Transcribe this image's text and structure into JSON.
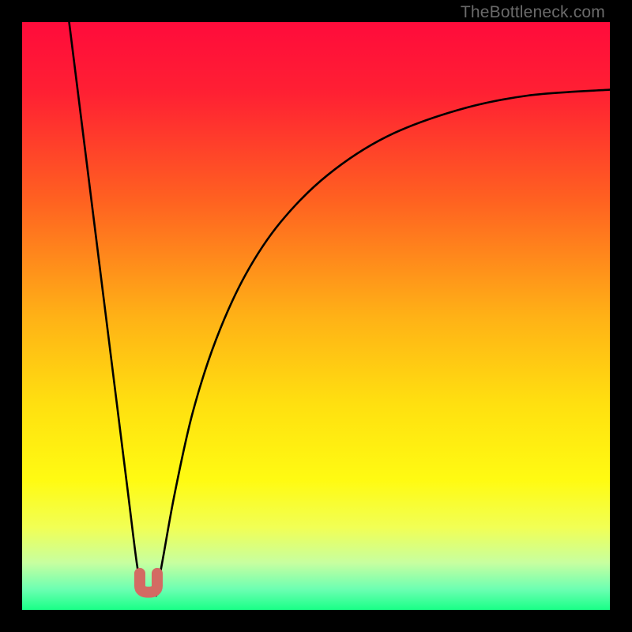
{
  "attribution": "TheBottleneck.com",
  "chart_data": {
    "type": "line",
    "title": "",
    "xlabel": "",
    "ylabel": "",
    "xlim": [
      0,
      100
    ],
    "ylim": [
      0,
      100
    ],
    "grid": false,
    "legend": false,
    "background_gradient": {
      "stops": [
        {
          "pos": 0.0,
          "color": "#ff0b3b"
        },
        {
          "pos": 0.12,
          "color": "#ff2033"
        },
        {
          "pos": 0.3,
          "color": "#ff6021"
        },
        {
          "pos": 0.5,
          "color": "#ffb116"
        },
        {
          "pos": 0.65,
          "color": "#ffe010"
        },
        {
          "pos": 0.78,
          "color": "#fffb12"
        },
        {
          "pos": 0.86,
          "color": "#f1ff55"
        },
        {
          "pos": 0.92,
          "color": "#c7ffa0"
        },
        {
          "pos": 0.965,
          "color": "#6cffb2"
        },
        {
          "pos": 1.0,
          "color": "#19ff87"
        }
      ]
    },
    "annotations": [
      {
        "name": "valley-marker",
        "shape": "U",
        "x": 21.5,
        "y": 3,
        "color": "#d36b63"
      }
    ],
    "series": [
      {
        "name": "left-branch",
        "x": [
          8.0,
          10.0,
          12.0,
          14.0,
          16.0,
          18.0,
          19.5,
          20.5
        ],
        "y": [
          100.0,
          84.0,
          68.0,
          52.0,
          36.0,
          20.0,
          8.0,
          2.4
        ]
      },
      {
        "name": "right-branch",
        "x": [
          22.8,
          24.0,
          26.0,
          29.0,
          33.0,
          38.0,
          44.0,
          52.0,
          62.0,
          74.0,
          86.0,
          100.0
        ],
        "y": [
          2.4,
          9.0,
          20.0,
          33.5,
          46.0,
          57.0,
          66.0,
          74.0,
          80.5,
          85.0,
          87.5,
          88.5
        ]
      }
    ]
  }
}
